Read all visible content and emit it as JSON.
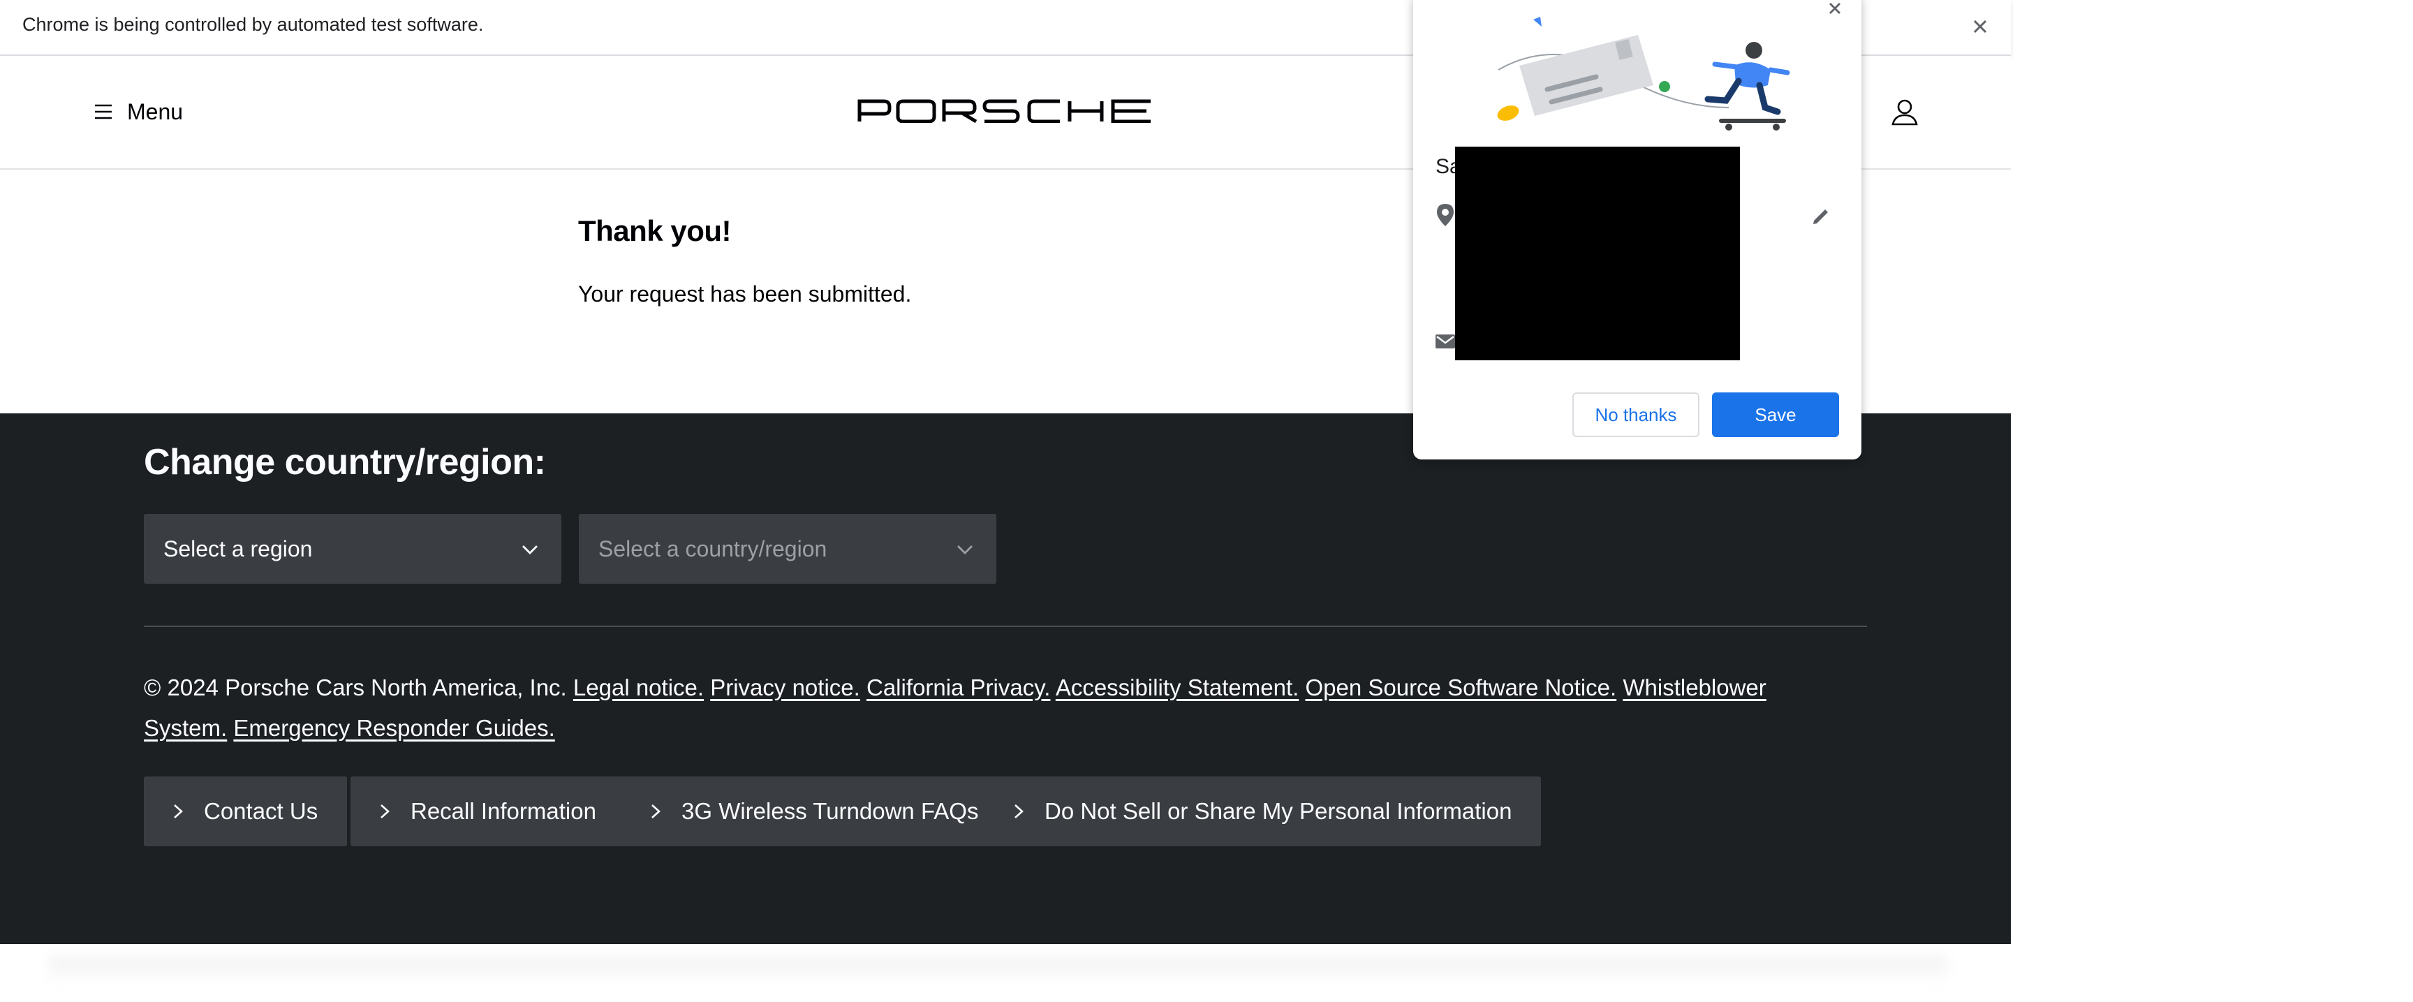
{
  "infobar": {
    "message": "Chrome is being controlled by automated test software.",
    "close_icon": "close-icon"
  },
  "header": {
    "menu_label": "Menu",
    "menu_icon": "hamburger-icon",
    "logo_text": "PORSCHE",
    "user_icon": "user-icon"
  },
  "main": {
    "title": "Thank you!",
    "subtitle": "Your request has been submitted."
  },
  "footer": {
    "heading": "Change country/region:",
    "region_select": {
      "placeholder": "Select a region"
    },
    "country_select": {
      "placeholder": "Select a country/region"
    },
    "copyright": "© 2024 Porsche Cars North America, Inc.",
    "legal_links": [
      "Legal notice.",
      "Privacy notice.",
      "California Privacy.",
      "Accessibility Statement.",
      "Open Source Software Notice.",
      "Whistleblower System.",
      "Emergency Responder Guides."
    ],
    "link_buttons": [
      "Contact Us",
      "Recall Information",
      "3G Wireless Turndown FAQs",
      "Do Not Sell or Share My Personal Information"
    ]
  },
  "save_popup": {
    "title_partial": "Sa",
    "no_thanks_label": "No thanks",
    "save_label": "Save",
    "accent": "#1a73e8"
  },
  "colors": {
    "footer_bg": "#1d2023",
    "button_bg": "#3a3d41",
    "text_light": "#fbfcff",
    "text_dark": "#010205"
  }
}
